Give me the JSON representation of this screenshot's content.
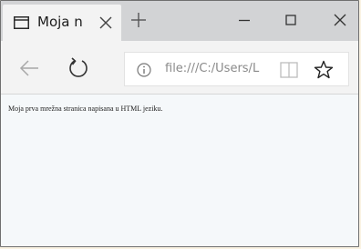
{
  "colors": {
    "titlebar": "#d2d3d5",
    "tab_active": "#f3f3f3",
    "content_bg": "#f5f8fa",
    "url_text": "#8a8a8a"
  },
  "tab": {
    "icon": "tab-page-icon",
    "title": "Moja n"
  },
  "window_controls": {
    "new_tab_icon": "plus-icon",
    "minimize_icon": "minimize-icon",
    "maximize_icon": "maximize-icon",
    "close_icon": "close-icon"
  },
  "navigation": {
    "back_icon": "back-arrow-icon",
    "refresh_icon": "refresh-icon",
    "address": {
      "info_icon": "info-icon",
      "url": "file:///C:/Users/L",
      "reading_view_icon": "reading-view-icon",
      "favorite_icon": "star-icon"
    }
  },
  "page": {
    "body_text": "Moja prva mrežna stranica napisana u HTML jeziku."
  }
}
